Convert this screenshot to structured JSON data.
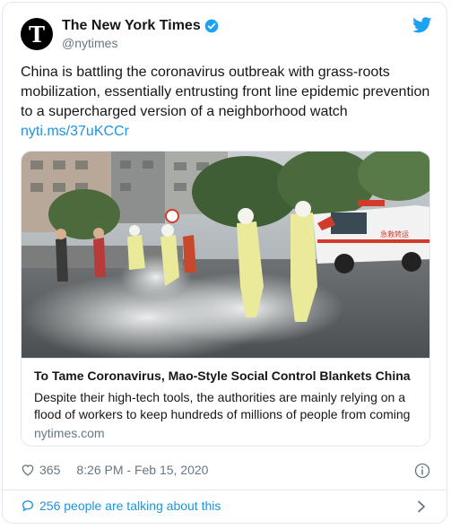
{
  "author": {
    "avatar_glyph": "T",
    "display_name": "The New York Times",
    "handle": "@nytimes"
  },
  "tweet": {
    "text": "China is battling the coronavirus outbreak with grass-roots mobilization, essentially entrusting front line epidemic prevention to a supercharged version of a neighborhood watch",
    "link": "nyti.ms/37uKCCr"
  },
  "card": {
    "title": "To Tame Coronavirus, Mao-Style Social Control Blankets China",
    "description": "Despite their high-tech tools, the authorities are mainly relying on a flood of workers to keep hundreds of millions of people from coming",
    "domain": "nytimes.com",
    "ambulance_sign": "急救转运"
  },
  "meta": {
    "likes": "365",
    "timestamp": "8:26 PM - Feb 15, 2020"
  },
  "footer": {
    "talking": "256 people are talking about this"
  },
  "colors": {
    "accent": "#1b95e0",
    "secondary_text": "#657786",
    "border": "#e1e8ed"
  },
  "icons": {
    "verified": "verified-badge-icon",
    "bird": "twitter-bird-icon",
    "like": "heart-icon",
    "info": "info-icon",
    "reply": "speech-bubble-icon",
    "more": "chevron-right-icon"
  }
}
